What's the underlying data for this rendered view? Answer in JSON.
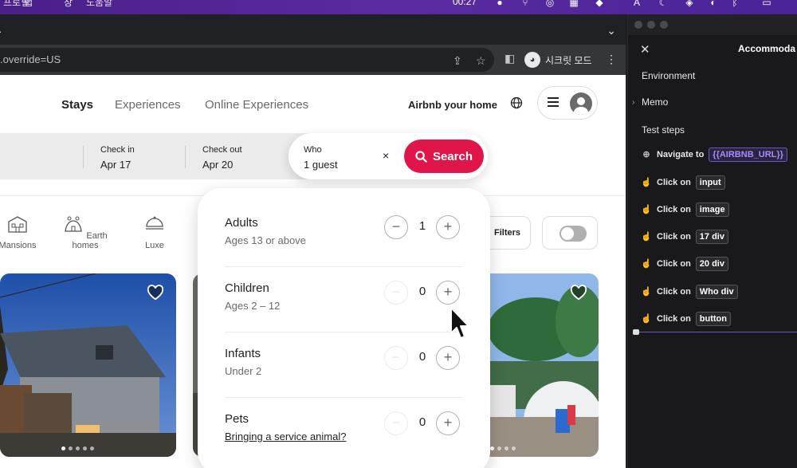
{
  "menubar": {
    "items": [
      "프로필",
      "탭",
      "창",
      "도움말"
    ],
    "clock": "00:27"
  },
  "browser": {
    "url": ".override=US",
    "incognito_label": "시크릿 모드"
  },
  "airbnb": {
    "nav": {
      "stays": "Stays",
      "experiences": "Experiences",
      "online": "Online Experiences"
    },
    "host_link": "Airbnb your home",
    "search": {
      "checkin_label": "Check in",
      "checkin_value": "Apr 17",
      "checkout_label": "Check out",
      "checkout_value": "Apr 20",
      "who_label": "Who",
      "who_value": "1 guest",
      "clear": "×",
      "button": "Search"
    },
    "categories": [
      "Mansions",
      "Earth homes",
      "Luxe"
    ],
    "filters": "Filters",
    "guests": [
      {
        "title": "Adults",
        "sub": "Ages 13 or above",
        "count": "1"
      },
      {
        "title": "Children",
        "sub": "Ages 2 – 12",
        "count": "0"
      },
      {
        "title": "Infants",
        "sub": "Under 2",
        "count": "0"
      },
      {
        "title": "Pets",
        "sub": "Bringing a service animal?",
        "count": "0"
      }
    ],
    "step_minus": "−",
    "step_plus": "+"
  },
  "panel": {
    "close": "✕",
    "title": "Accommoda",
    "sections": {
      "environment": "Environment",
      "memo": "Memo",
      "test_steps": "Test steps"
    },
    "steps": [
      {
        "action": "Navigate to",
        "target": "{{AIRBNB_URL}}"
      },
      {
        "action": "Click on",
        "target": "input"
      },
      {
        "action": "Click on",
        "target": "image"
      },
      {
        "action": "Click on",
        "target": "17 div"
      },
      {
        "action": "Click on",
        "target": "20 div"
      },
      {
        "action": "Click on",
        "target": "Who div"
      },
      {
        "action": "Click on",
        "target": "button"
      }
    ]
  },
  "colors": {
    "brand": "#e0154a",
    "panel_bg": "#19191c",
    "variable_chip": "#a88cff"
  }
}
